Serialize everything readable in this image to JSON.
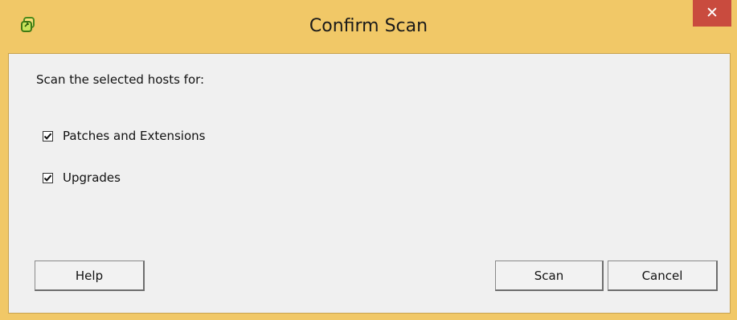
{
  "window": {
    "title": "Confirm Scan",
    "close_glyph": "✕",
    "app_icon": "vsphere-app-icon",
    "accent_color": "#f1c867",
    "close_color": "#c94b3e"
  },
  "prompt": "Scan the selected hosts for:",
  "options": [
    {
      "label": "Patches and Extensions",
      "checked": true
    },
    {
      "label": "Upgrades",
      "checked": true
    }
  ],
  "buttons": {
    "help": "Help",
    "scan": "Scan",
    "cancel": "Cancel"
  }
}
